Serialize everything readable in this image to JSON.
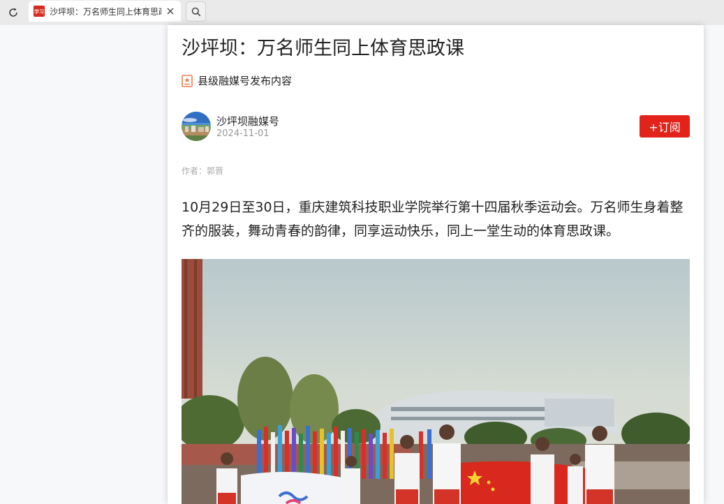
{
  "browser": {
    "tab_title": "沙坪坝：万名师生同上体育思政课",
    "favicon_text": "学习"
  },
  "article": {
    "title": "沙坪坝：万名师生同上体育思政课",
    "source_tag": "县级融媒号发布内容",
    "account_name": "沙坪坝融媒号",
    "date": "2024-11-01",
    "subscribe_label": "+订阅",
    "byline": "作者：郭晋",
    "lead": "10月29日至30日，重庆建筑科技职业学院举行第十四届秋季运动会。万名师生身着整齐的服装，舞动青春的韵律，同享运动快乐，同上一堂生动的体育思政课。"
  },
  "colors": {
    "accent": "#e2231a",
    "tag_icon": "#f07c4e"
  },
  "icons": [
    "reload-icon",
    "close-icon",
    "search-icon",
    "badge-icon"
  ]
}
